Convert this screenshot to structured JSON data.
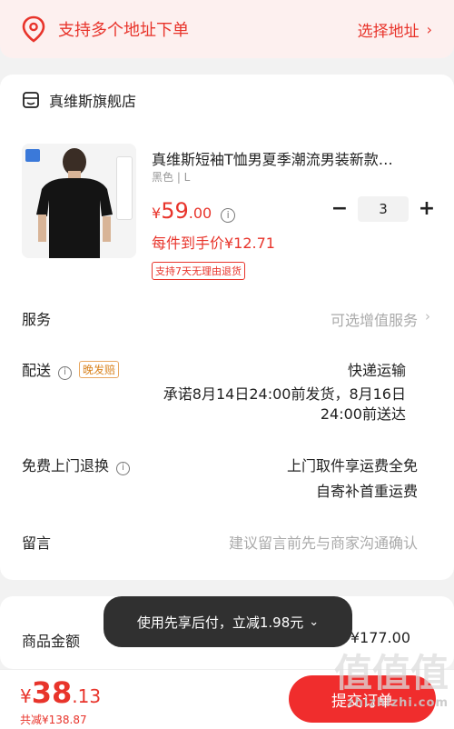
{
  "address_bar": {
    "label": "支持多个地址下单",
    "select_label": "选择地址",
    "chevron": "›"
  },
  "store": {
    "name": "真维斯旗舰店"
  },
  "product": {
    "title": "真维斯短袖T恤男夏季潮流男装新款…",
    "spec": "黑色 | L",
    "price_yen": "¥",
    "price_int": "59",
    "price_dec": ".00",
    "final_price": "每件到手价¥12.71",
    "return_tag": "支持7天无理由退货",
    "quantity": "3",
    "minus": "−",
    "plus": "+"
  },
  "rows": {
    "service": {
      "label": "服务",
      "value": "可选增值服务",
      "chevron": "›"
    },
    "delivery": {
      "label": "配送",
      "tag": "晚发赔",
      "method": "快递运输",
      "promise_line1": "承诺8月14日24:00前发货，8月16日",
      "promise_line2": "24:00前送达"
    },
    "return_pickup": {
      "label": "免费上门退换",
      "line1": "上门取件享运费全免",
      "line2": "自寄补首重运费"
    },
    "message": {
      "label": "留言",
      "placeholder": "建议留言前先与商家沟通确认"
    }
  },
  "summary": {
    "goods_amount_label": "商品金额",
    "goods_amount_value": "¥177.00"
  },
  "toast": {
    "text": "使用先享后付，立减1.98元",
    "chevron": "⌄"
  },
  "bottom": {
    "yen": "¥",
    "total_int": "38",
    "total_dec": ".13",
    "saving": "共减¥138.87",
    "submit_label": "提交订单"
  },
  "watermark": {
    "text": "值值值",
    "domain": "zhizhizhi.com"
  },
  "icons": {
    "location": "location-pin-icon",
    "store": "store-icon",
    "info": "info-icon"
  },
  "colors": {
    "accent": "#e8342b",
    "submit": "#f02d2d",
    "address_bg": "#fdf0ef"
  }
}
